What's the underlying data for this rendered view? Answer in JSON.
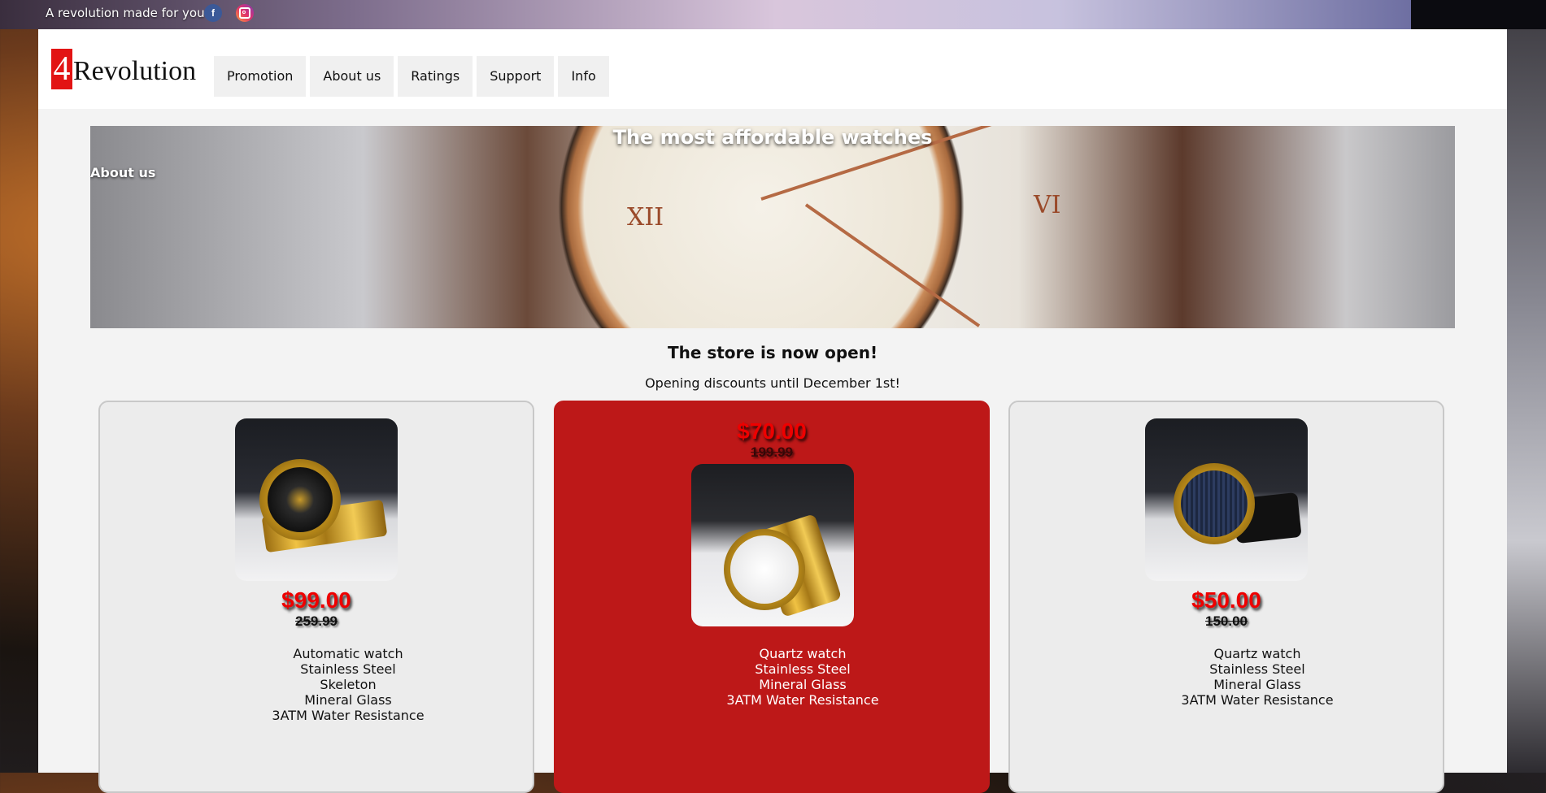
{
  "topbar": {
    "tagline": "A revolution made for you",
    "facebook_icon": "f"
  },
  "header": {
    "logo": {
      "mark": "4",
      "text": "Revolution"
    },
    "nav": [
      "Promotion",
      "About us",
      "Ratings",
      "Support",
      "Info"
    ]
  },
  "hero": {
    "title": "The most affordable watches",
    "about_link": "About us",
    "dial_numerals": [
      "XII",
      "VI"
    ]
  },
  "store": {
    "title": "The store is now open!",
    "subtitle": "Opening discounts until December 1st!"
  },
  "products": [
    {
      "price_new": "$99.00",
      "price_old": "259.99",
      "features": [
        "Automatic watch",
        "Stainless Steel",
        "Skeleton",
        "Mineral Glass",
        "3ATM Water Resistance"
      ],
      "featured": false
    },
    {
      "price_new": "$70.00",
      "price_old": "199.99",
      "features": [
        "Quartz watch",
        "Stainless Steel",
        "Mineral Glass",
        "3ATM Water Resistance"
      ],
      "featured": true
    },
    {
      "price_new": "$50.00",
      "price_old": "150.00",
      "features": [
        "Quartz watch",
        "Stainless Steel",
        "Mineral Glass",
        "3ATM Water Resistance"
      ],
      "featured": false
    }
  ],
  "colors": {
    "accent": "#e21414",
    "featured_card": "#bd1818",
    "price": "#ee0000"
  }
}
